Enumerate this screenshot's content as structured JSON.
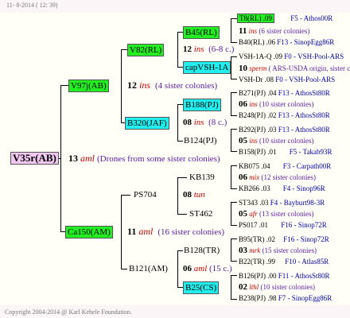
{
  "header": {
    "date": "11- 8-2014 ( 12: 39)"
  },
  "footer": {
    "copyright": "Copyright 2004-2014 @ Karl Kehele Foundation."
  },
  "root": {
    "code": "V35r(AB)",
    "year": "13",
    "line": "aml",
    "note": "(Drones from some sister colonies)"
  },
  "g1": [
    {
      "code": "V97j(AB)",
      "year": "12",
      "line": "ins",
      "note": "(4 sister colonies)"
    },
    {
      "code": "Ca150(AM)",
      "year": "11",
      "line": "aml",
      "note": "(16 sister colonies)"
    }
  ],
  "g2": [
    {
      "code": "V82(RL)",
      "year": "12",
      "line": "ins",
      "note": "(6-8 c.)"
    },
    {
      "code": "B320(JAF)",
      "year": "08",
      "line": "ins",
      "note": "(8 c.)"
    },
    {
      "code": "PS704",
      "year": "08",
      "line": "tun",
      "note": ""
    },
    {
      "code": "B121(AM)",
      "year": "06",
      "line": "aml",
      "note": "(15 c.)"
    }
  ],
  "g3": [
    {
      "code": "B45(RL)"
    },
    {
      "code": "capVSH-1A"
    },
    {
      "code": "B188(PJ)"
    },
    {
      "code": "B124(PJ)"
    },
    {
      "code": "KB139"
    },
    {
      "code": "ST462"
    },
    {
      "code": "B128(TR)"
    },
    {
      "code": "B25(CS)"
    }
  ],
  "g4": [
    {
      "top": "T8(RL) .09",
      "topRight": "F5 - Athos00R",
      "year": "11",
      "line": "ins",
      "note": "(6 sister colonies)",
      "bottom": "B40(RL) .06",
      "bottomRight": "F13 - SinopEgg86R"
    },
    {
      "top": "VSH-1A-Q .09",
      "topRight": "F0 - VSH-Pool-ARS",
      "year": "10",
      "line": "sperm",
      "note": "( ARS-USDA origin, sister colonies)",
      "bottom": "VSH-Dr .08",
      "bottomRight": "F0 - VSH-Pool-ARS"
    },
    {
      "top": "B271(PJ) .04",
      "topRight": "F13 - AthosSt80R",
      "year": "06",
      "line": "ins",
      "note": "(10 sister colonies)",
      "bottom": "B248(PJ) .02",
      "bottomRight": "F13 - AthosSt80R"
    },
    {
      "top": "B292(PJ) .03",
      "topRight": "F13 - AthosSt80R",
      "year": "05",
      "line": "ins",
      "note": "(10 sister colonies)",
      "bottom": "B158(PJ) .01",
      "bottomRight": "F5 - Takab93R"
    },
    {
      "top": "KB075 .04",
      "topRight": "F3 - Carpath00R",
      "year": "06",
      "line": "mix",
      "note": "(12 sister colonies)",
      "bottom": "KB266 .03",
      "bottomRight": "F4 - Sinop96R"
    },
    {
      "top": "ST343 .03",
      "topRight": "F4 - Bayburt98-3R",
      "year": "05",
      "line": "afr",
      "note": "(13 sister colonies)",
      "bottom": "PS017 .01",
      "bottomRight": "F16 - Sinop72R"
    },
    {
      "top": "B95(TR) .02",
      "topRight": "F16 - Sinop72R",
      "year": "03",
      "line": "mrk",
      "note": "(15 sister colonies)",
      "bottom": "B22(TR) .99",
      "bottomRight": "F10 - Atlas85R"
    },
    {
      "top": "B126(PJ) .00",
      "topRight": "F11 - AthosSt80R",
      "year": "02",
      "line": "lthl",
      "note": "(10 sister colonies)",
      "bottom": "B238(PJ) .98",
      "bottomRight": "F7 - SinopEgg86R"
    }
  ],
  "colors": {
    "green": "#22ee22",
    "cyan": "#22eeee",
    "pink": "#f2c8f2",
    "year_red": "#cc0000",
    "note_purple": "#5a1aa0"
  }
}
